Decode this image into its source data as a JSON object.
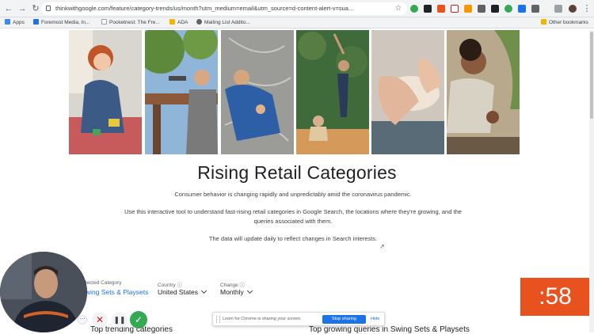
{
  "browser": {
    "url": "thinkwithgoogle.com/feature/category-trends/us/month?utm_medium=email&utm_source=d-content-alert-v=sua...",
    "bookmarks": [
      "Apps",
      "Foremost Media, In...",
      "Pocketnest: The Fre...",
      "ADA",
      "Mailing List Addito..."
    ],
    "other_bookmarks": "Other bookmarks"
  },
  "hero": {
    "title": "Rising Retail Categories",
    "paragraphs": [
      "Consumer behavior is changing rapidly and unpredictably amid the coronavirus pandemic.",
      "Use this interactive tool to understand fast-rising retail categories in Google Search, the locations where they're growing, and the queries associated with them.",
      "The data will update daily to reflect changes in Search interests."
    ]
  },
  "filters": {
    "category_label": "lected Category",
    "category_value": "wing Sets & Playsets",
    "country_label": "Country ⓘ",
    "country_value": "United States",
    "change_label": "Change ⓘ",
    "change_value": "Monthly"
  },
  "sections": {
    "left_heading": "Top trending categories",
    "right_heading": "Top growing queries in Swing Sets & Playsets"
  },
  "share_banner": {
    "message": "Loom for Chrome is sharing your screen.",
    "stop_label": "Stop sharing",
    "hide_label": "Hide"
  },
  "timer": ":58",
  "colors": {
    "accent_blue": "#1a73e8",
    "timer_orange": "#e8521f",
    "confirm_green": "#34a853",
    "category_link": "#1a73e8"
  }
}
